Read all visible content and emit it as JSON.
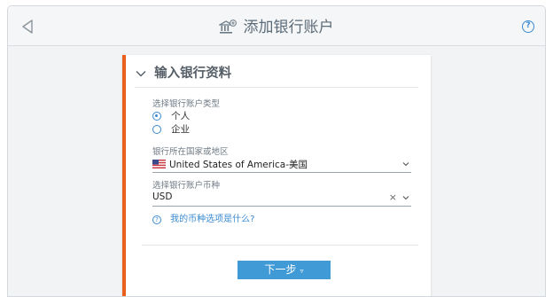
{
  "header": {
    "back_icon": "back-triangle-icon",
    "title_icon": "bank-add-icon",
    "title": "添加银行账户",
    "help_icon": "question-circle-icon",
    "help_glyph": "?"
  },
  "section": {
    "title": "输入银行资料",
    "collapse_icon": "chevron-down-icon"
  },
  "account_type": {
    "label": "选择银行账户类型",
    "options": [
      {
        "label": "个人",
        "checked": true
      },
      {
        "label": "企业",
        "checked": false
      }
    ]
  },
  "country": {
    "label": "银行所在国家或地区",
    "value": "United States of America-美国",
    "flag_icon": "us-flag-icon"
  },
  "currency": {
    "label": "选择银行账户币种",
    "value": "USD",
    "clear_glyph": "×"
  },
  "help_link": {
    "text": "我的币种选项是什么?",
    "glyph": "?"
  },
  "next_button": {
    "label": "下一步",
    "arrow": "▿"
  },
  "colors": {
    "accent": "#e8601c",
    "primary": "#3f9ad6",
    "link": "#3a8ad0"
  }
}
